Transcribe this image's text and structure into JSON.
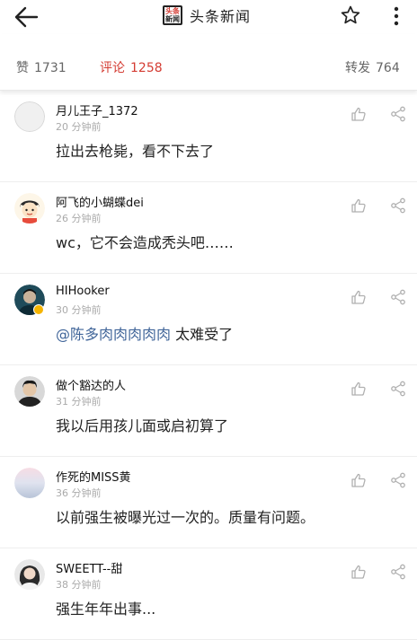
{
  "header": {
    "logo_top": "头条",
    "logo_bottom": "新闻",
    "title": "头条新闻",
    "back_icon": "back-arrow-icon",
    "star_icon": "star-icon",
    "more_icon": "more-vertical-icon"
  },
  "stats": {
    "likes_label": "赞",
    "likes_count": "1731",
    "comments_label": "评论",
    "comments_count": "1258",
    "reposts_label": "转发",
    "reposts_count": "764",
    "active_color": "#d43c33"
  },
  "comments": [
    {
      "name": "月儿王子_1372",
      "time": "20 分钟前",
      "text": "拉出去枪毙，看不下去了",
      "avatar": "default"
    },
    {
      "name": "阿飞的小蝴蝶dei",
      "time": "26 分钟前",
      "text": "wc，它不会造成秃头吧……",
      "avatar": "cartoon"
    },
    {
      "name": "HIHooker",
      "time": "30 分钟前",
      "mention": "@陈多肉肉肉肉肉",
      "text": " 太难受了",
      "avatar": "photo-blue",
      "verified": true
    },
    {
      "name": "做个豁达的人",
      "time": "31 分钟前",
      "text": "我以后用孩儿面或启初算了",
      "avatar": "photo-dark"
    },
    {
      "name": "作死的MISS黄",
      "time": "36 分钟前",
      "text": "以前强生被曝光过一次的。质量有问题。",
      "avatar": "gradient"
    },
    {
      "name": "SWEETT--甜",
      "time": "38 分钟前",
      "text": "强生年年出事...",
      "avatar": "photo-girl"
    }
  ]
}
